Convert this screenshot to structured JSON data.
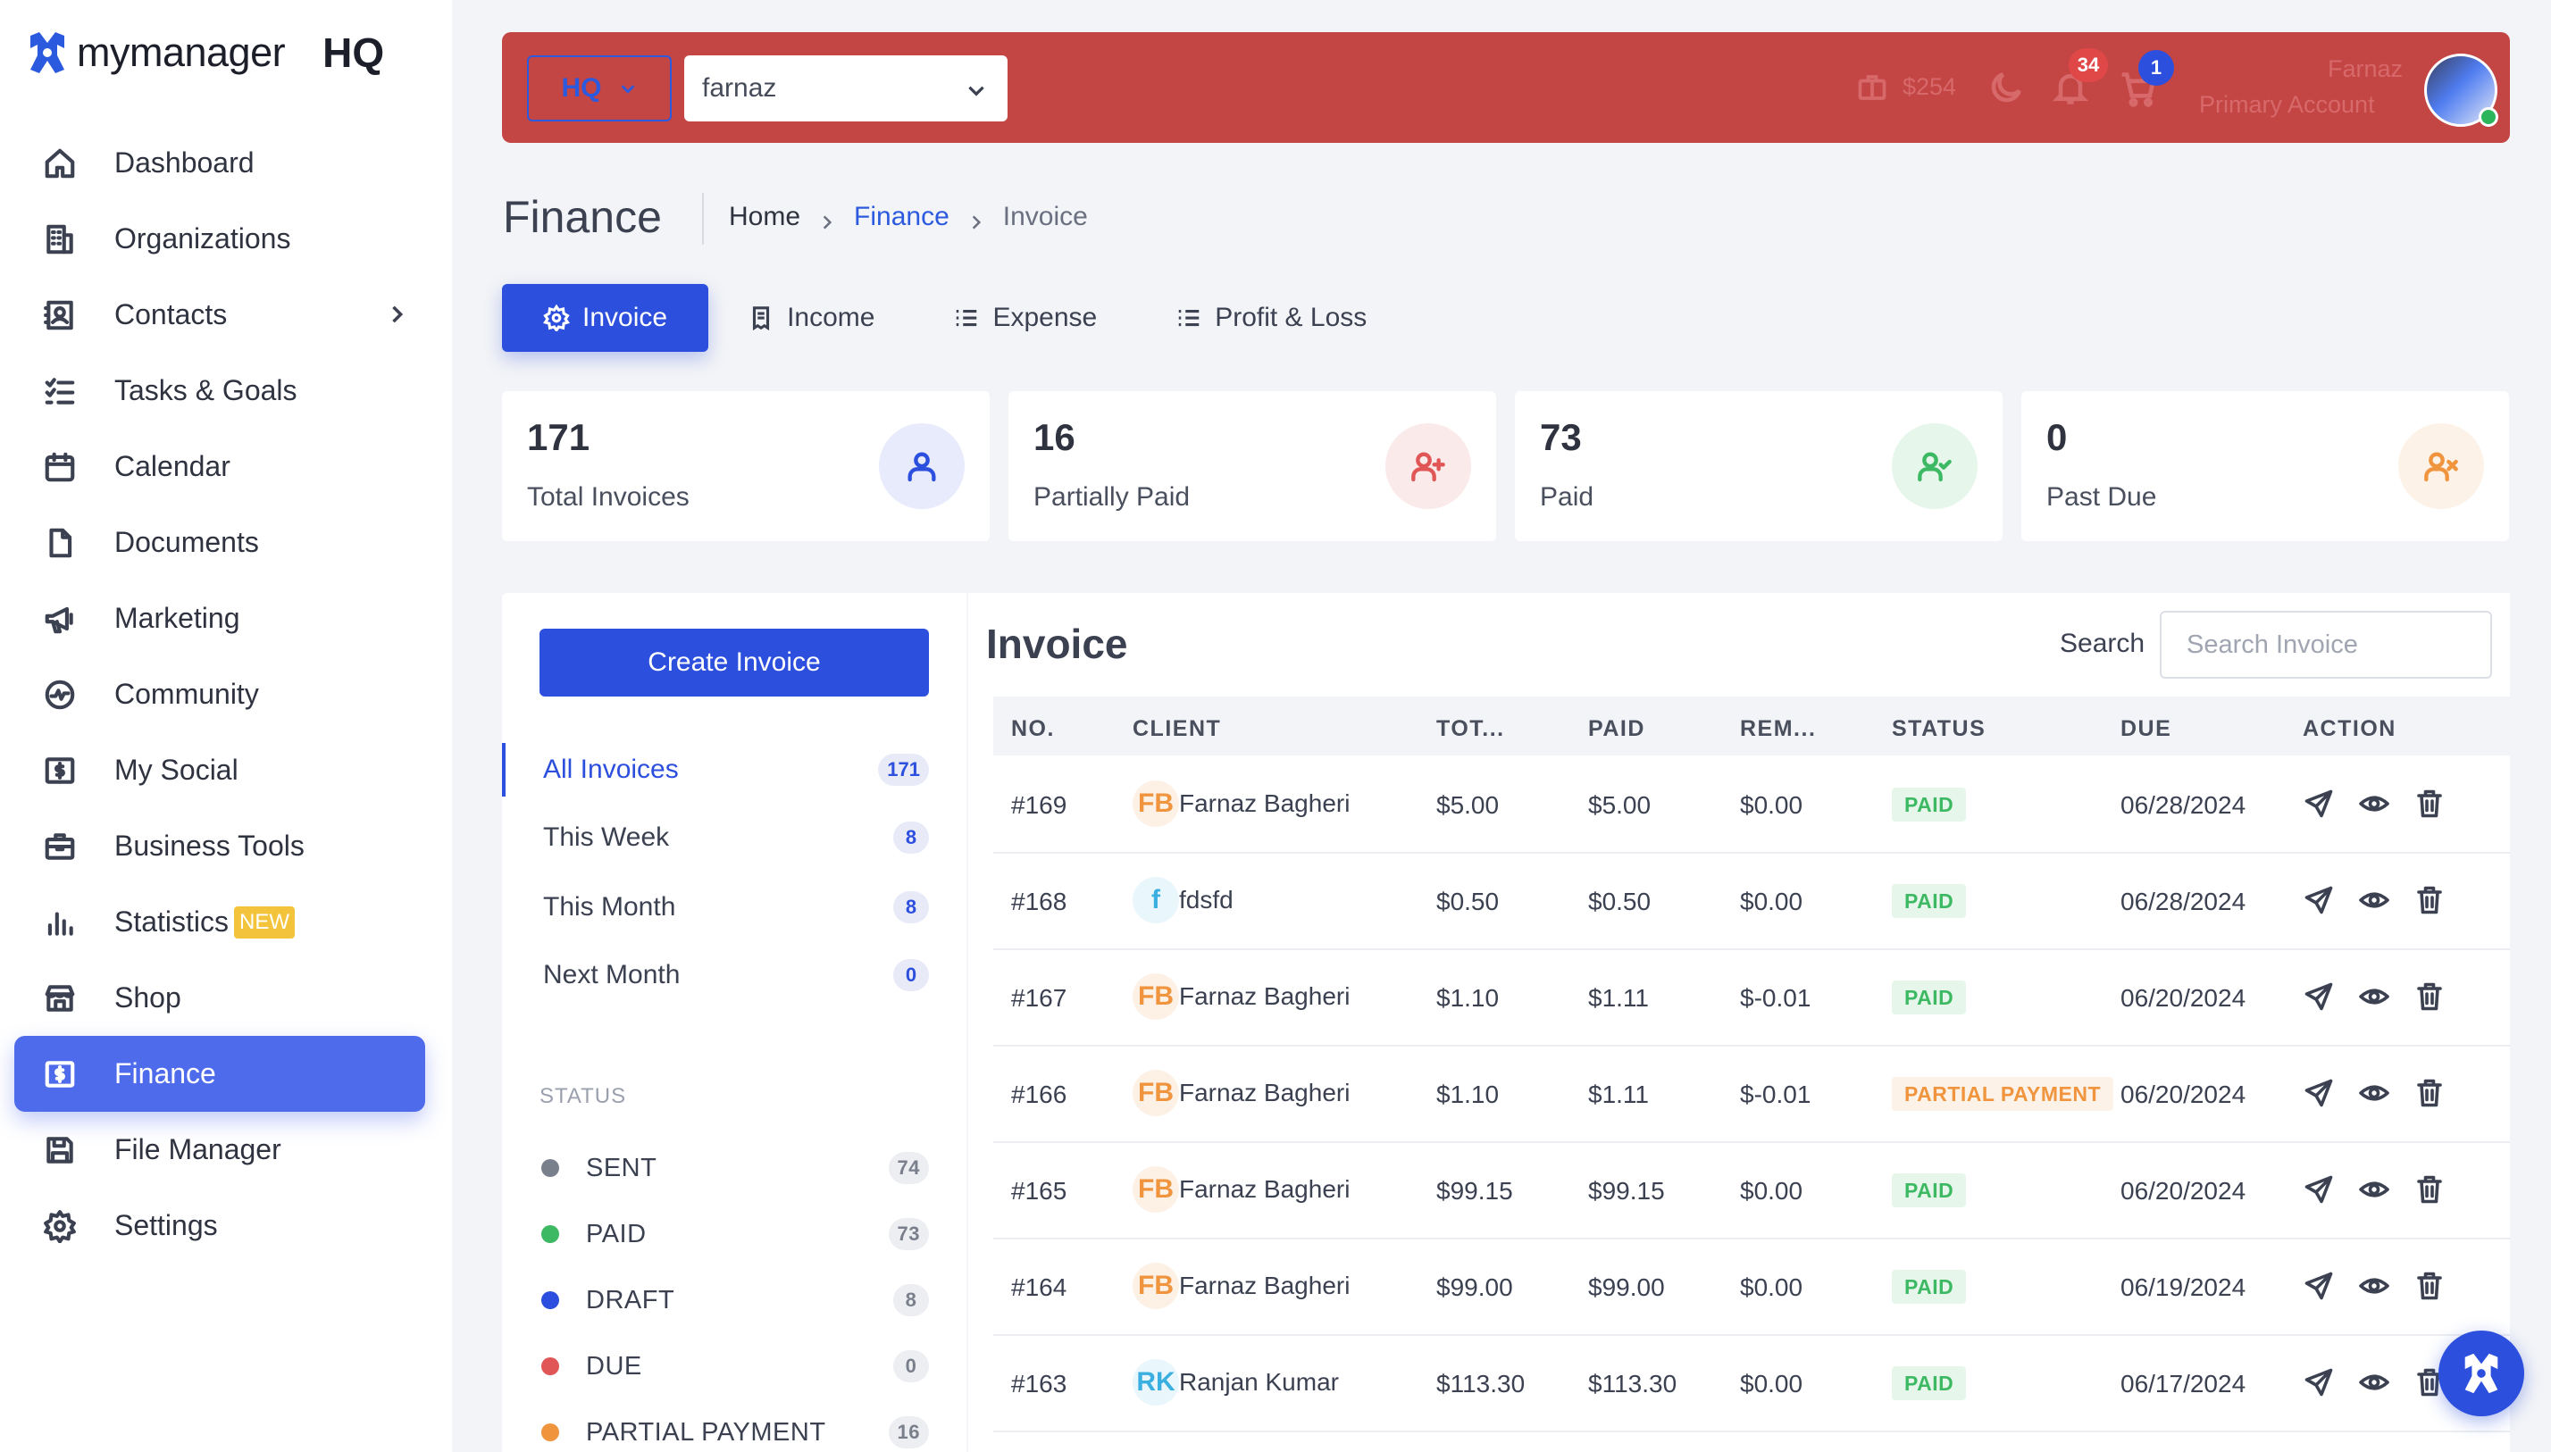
{
  "brand": {
    "name": "mymanager",
    "suffix": "HQ"
  },
  "sidebar": {
    "items": [
      {
        "label": "Dashboard",
        "icon": "home-icon"
      },
      {
        "label": "Organizations",
        "icon": "building-icon"
      },
      {
        "label": "Contacts",
        "icon": "contacts-icon"
      },
      {
        "label": "Tasks & Goals",
        "icon": "checklist-icon"
      },
      {
        "label": "Calendar",
        "icon": "calendar-icon"
      },
      {
        "label": "Documents",
        "icon": "file-icon"
      },
      {
        "label": "Marketing",
        "icon": "megaphone-icon"
      },
      {
        "label": "Community",
        "icon": "pulse-icon"
      },
      {
        "label": "My Social",
        "icon": "dollar-box-icon"
      },
      {
        "label": "Business Tools",
        "icon": "briefcase-icon"
      },
      {
        "label": "Statistics",
        "icon": "bar-chart-icon",
        "badge": "NEW"
      },
      {
        "label": "Shop",
        "icon": "store-icon"
      },
      {
        "label": "Finance",
        "icon": "dollar-box-icon",
        "active": true
      },
      {
        "label": "File Manager",
        "icon": "save-icon"
      },
      {
        "label": "Settings",
        "icon": "gear-icon"
      }
    ]
  },
  "topbar": {
    "org_select": "HQ",
    "user_select": "farnaz",
    "faded_amount": "$254",
    "notifications_count": "34",
    "cart_count": "1",
    "user_name": "Farnaz",
    "user_role": "Primary Account",
    "colors": {
      "bar": "#c34544",
      "accent": "#2c5adf"
    }
  },
  "page": {
    "title": "Finance",
    "breadcrumb": [
      "Home",
      "Finance",
      "Invoice"
    ]
  },
  "tabs": [
    {
      "label": "Invoice",
      "icon": "gear-icon",
      "active": true
    },
    {
      "label": "Income",
      "icon": "receipt-icon"
    },
    {
      "label": "Expense",
      "icon": "list-icon"
    },
    {
      "label": "Profit & Loss",
      "icon": "list-icon"
    }
  ],
  "stats": [
    {
      "value": "171",
      "label": "Total Invoices",
      "icon": "user-icon",
      "color": "#2c4fdd",
      "bg": "#e8ebfb"
    },
    {
      "value": "16",
      "label": "Partially Paid",
      "icon": "user-plus-icon",
      "color": "#e05555",
      "bg": "#fbeaea"
    },
    {
      "value": "73",
      "label": "Paid",
      "icon": "user-check-icon",
      "color": "#3db963",
      "bg": "#e6f6ea"
    },
    {
      "value": "0",
      "label": "Past Due",
      "icon": "user-x-icon",
      "color": "#f0943e",
      "bg": "#fdf2e8"
    }
  ],
  "filters": {
    "create_label": "Create Invoice",
    "periods": [
      {
        "label": "All Invoices",
        "count": "171",
        "active": true
      },
      {
        "label": "This Week",
        "count": "8"
      },
      {
        "label": "This Month",
        "count": "8"
      },
      {
        "label": "Next Month",
        "count": "0"
      }
    ],
    "status_title": "STATUS",
    "statuses": [
      {
        "label": "SENT",
        "count": "74",
        "color": "#7a7f8c"
      },
      {
        "label": "PAID",
        "count": "73",
        "color": "#3db963"
      },
      {
        "label": "DRAFT",
        "count": "8",
        "color": "#2c4fdd"
      },
      {
        "label": "DUE",
        "count": "0",
        "color": "#e05555"
      },
      {
        "label": "PARTIAL PAYMENT",
        "count": "16",
        "color": "#f0943e"
      }
    ]
  },
  "invoice_table": {
    "title": "Invoice",
    "search_label": "Search",
    "search_placeholder": "Search Invoice",
    "columns": [
      "NO.",
      "CLIENT",
      "TOT...",
      "PAID",
      "REM...",
      "STATUS",
      "DUE",
      "ACTION"
    ],
    "rows": [
      {
        "no": "#169",
        "initials": "FB",
        "client": "Farnaz Bagheri",
        "total": "$5.00",
        "paid": "$5.00",
        "remaining": "$0.00",
        "status": "PAID",
        "due": "06/28/2024"
      },
      {
        "no": "#168",
        "initials": "f",
        "client": "fdsfd",
        "total": "$0.50",
        "paid": "$0.50",
        "remaining": "$0.00",
        "status": "PAID",
        "due": "06/28/2024"
      },
      {
        "no": "#167",
        "initials": "FB",
        "client": "Farnaz Bagheri",
        "total": "$1.10",
        "paid": "$1.11",
        "remaining": "$-0.01",
        "status": "PAID",
        "due": "06/20/2024"
      },
      {
        "no": "#166",
        "initials": "FB",
        "client": "Farnaz Bagheri",
        "total": "$1.10",
        "paid": "$1.11",
        "remaining": "$-0.01",
        "status": "PARTIAL PAYMENT",
        "due": "06/20/2024"
      },
      {
        "no": "#165",
        "initials": "FB",
        "client": "Farnaz Bagheri",
        "total": "$99.15",
        "paid": "$99.15",
        "remaining": "$0.00",
        "status": "PAID",
        "due": "06/20/2024"
      },
      {
        "no": "#164",
        "initials": "FB",
        "client": "Farnaz Bagheri",
        "total": "$99.00",
        "paid": "$99.00",
        "remaining": "$0.00",
        "status": "PAID",
        "due": "06/19/2024"
      },
      {
        "no": "#163",
        "initials": "RK",
        "client": "Ranjan Kumar",
        "total": "$113.30",
        "paid": "$113.30",
        "remaining": "$0.00",
        "status": "PAID",
        "due": "06/17/2024"
      }
    ]
  }
}
